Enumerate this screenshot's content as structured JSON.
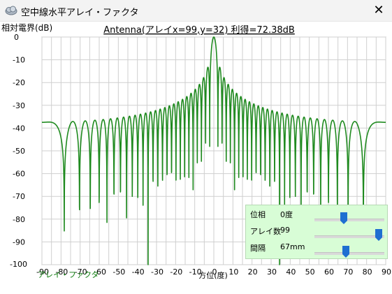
{
  "window": {
    "title": "空中線水平アレイ・ファクタ",
    "icon": "cloud-app-icon",
    "close_icon": "close-icon"
  },
  "colors": {
    "plot_line": "#1f8a1f",
    "grid": "#cfcfcf",
    "panel_bg": "#d8fdd6",
    "thumb": "#1f6fd1",
    "caption": "#0a7a0a"
  },
  "chart": {
    "title": "Antenna(アレイx=99,y=32) 利得=72.38dB",
    "ylabel": "相対電界(dB)",
    "xlabel": "方位(度)",
    "caption": "アレイ・ファクタ"
  },
  "chart_data": {
    "type": "line",
    "title": "Antenna(アレイx=99,y=32) 利得=72.38dB",
    "xlabel": "方位(度)",
    "ylabel": "相対電界(dB)",
    "xlim": [
      -90,
      90
    ],
    "ylim": [
      -100,
      0
    ],
    "xticks": [
      -90,
      -80,
      -70,
      -60,
      -50,
      -40,
      -30,
      -20,
      -10,
      0,
      10,
      20,
      30,
      40,
      50,
      60,
      70,
      80,
      90
    ],
    "yticks": [
      0,
      -10,
      -20,
      -30,
      -40,
      -50,
      -60,
      -70,
      -80,
      -90,
      -100
    ],
    "grid": true,
    "model": {
      "elements": 99,
      "spacing_mm": 67,
      "phase_deg": 0,
      "floor_db": -100
    }
  },
  "controls": {
    "phase": {
      "label": "位相",
      "value": "0度",
      "fraction": 0.42
    },
    "array_count": {
      "label": "アレイ数",
      "value": "99",
      "fraction": 0.92
    },
    "spacing": {
      "label": "間隔",
      "value": "67mm",
      "fraction": 0.45
    }
  }
}
